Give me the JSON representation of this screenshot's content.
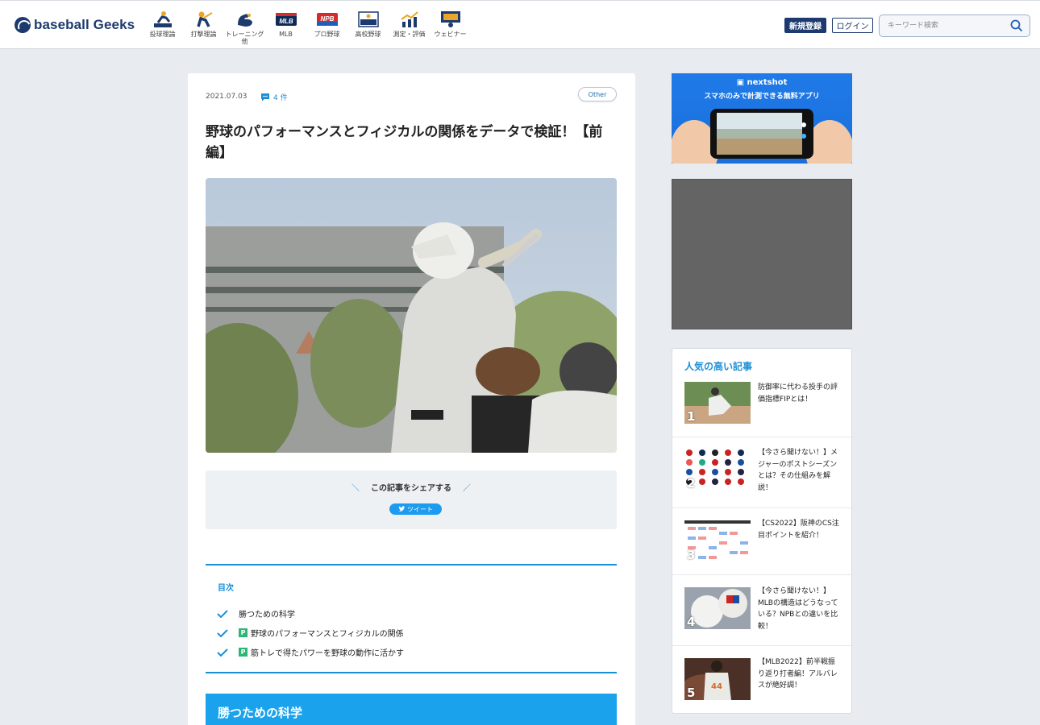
{
  "header": {
    "logo_text": "baseball Geeks",
    "nav": [
      {
        "label": "投球理論",
        "icon": "pitcher-icon"
      },
      {
        "label": "打撃理論",
        "icon": "batter-icon"
      },
      {
        "label": "トレーニング\n他",
        "icon": "muscle-arm-icon"
      },
      {
        "label": "MLB",
        "icon": "mlb-badge-icon"
      },
      {
        "label": "プロ野球",
        "icon": "npb-badge-icon"
      },
      {
        "label": "高校野球",
        "icon": "scoreboard-icon"
      },
      {
        "label": "測定・評価",
        "icon": "chart-up-icon"
      },
      {
        "label": "ウェビナー",
        "icon": "presenter-icon"
      }
    ],
    "signup_label": "新規登録",
    "login_label": "ログイン",
    "search_placeholder": "キーワード検索"
  },
  "article": {
    "date": "2021.07.03",
    "comments": "4 件",
    "tag": "Other",
    "title": "野球のパフォーマンスとフィジカルの関係をデータで検証！【前編】",
    "share": {
      "label": "この記事をシェアする",
      "tweet_label": "ツイート"
    },
    "toc": {
      "title": "目次",
      "items": [
        {
          "label": "勝つための科学",
          "badge": ""
        },
        {
          "label": "野球のパフォーマンスとフィジカルの関係",
          "badge": "P"
        },
        {
          "label": "筋トレで得たパワーを野球の動作に活かす",
          "badge": "P"
        }
      ]
    },
    "section_heading": "勝つための科学"
  },
  "sidebar": {
    "ad": {
      "brand": "nextshot",
      "tagline": "スマホのみで計測できる無料アプリ"
    },
    "popular": {
      "title": "人気の高い記事",
      "items": [
        {
          "rank": "1",
          "title": "防御率に代わる投手の評価指標FIPとは！"
        },
        {
          "rank": "2",
          "title": "【今さら聞けない！】メジャーのポストシーズンとは？その仕組みを解説！"
        },
        {
          "rank": "3",
          "title": "【CS2022】阪神のCS注目ポイントを紹介！"
        },
        {
          "rank": "4",
          "title": "【今さら聞けない！】MLBの構造はどうなっている？NPBとの違いを比較！"
        },
        {
          "rank": "5",
          "title": "【MLB2022】前半戦振り返り打者編！アルバレスが絶好調！"
        }
      ]
    }
  },
  "colors": {
    "brand_navy": "#1d3a6e",
    "accent_blue": "#1b8fd6",
    "section_blue": "#1aa3ec",
    "page_bg": "#e8ecf1"
  }
}
